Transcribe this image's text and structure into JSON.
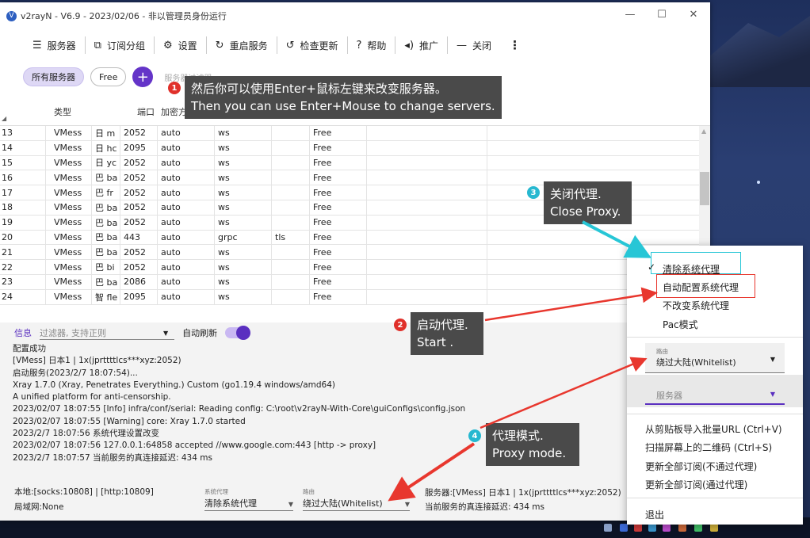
{
  "window": {
    "title": "v2rayN - V6.9 - 2023/02/06 - 非以管理员身份运行",
    "min_glyph": "—",
    "max_glyph": "☐",
    "close_glyph": "✕"
  },
  "toolbar": {
    "items": [
      {
        "icon": "server-icon",
        "glyph": "☰",
        "label": "服务器"
      },
      {
        "icon": "subscription-icon",
        "glyph": "⧉",
        "label": "订阅分组"
      },
      {
        "icon": "settings-icon",
        "glyph": "⚙",
        "label": "设置"
      },
      {
        "icon": "restart-icon",
        "glyph": "↻",
        "label": "重启服务"
      },
      {
        "icon": "update-icon",
        "glyph": "↺",
        "label": "检查更新"
      },
      {
        "icon": "help-icon",
        "glyph": "?",
        "label": "帮助"
      },
      {
        "icon": "promote-icon",
        "glyph": "◂)",
        "label": "推广"
      },
      {
        "icon": "close-icon",
        "glyph": "—",
        "label": "关闭"
      }
    ],
    "more_glyph": "⋮"
  },
  "filters": {
    "chips": [
      "所有服务器",
      "Free"
    ],
    "add_glyph": "+",
    "faint_label": "服务器过滤器"
  },
  "grid": {
    "headers": [
      "类型",
      "端口",
      "加密方式"
    ],
    "rows": [
      {
        "idx": "13",
        "type": "VMess",
        "rem": "日 m",
        "port": "2052",
        "sec": "auto",
        "net": "ws",
        "tls": "",
        "sub": "Free"
      },
      {
        "idx": "14",
        "type": "VMess",
        "rem": "日 hc",
        "port": "2095",
        "sec": "auto",
        "net": "ws",
        "tls": "",
        "sub": "Free"
      },
      {
        "idx": "15",
        "type": "VMess",
        "rem": "日 yc",
        "port": "2052",
        "sec": "auto",
        "net": "ws",
        "tls": "",
        "sub": "Free"
      },
      {
        "idx": "16",
        "type": "VMess",
        "rem": "巴 ba",
        "port": "2052",
        "sec": "auto",
        "net": "ws",
        "tls": "",
        "sub": "Free"
      },
      {
        "idx": "17",
        "type": "VMess",
        "rem": "巴 fr",
        "port": "2052",
        "sec": "auto",
        "net": "ws",
        "tls": "",
        "sub": "Free"
      },
      {
        "idx": "18",
        "type": "VMess",
        "rem": "巴 ba",
        "port": "2052",
        "sec": "auto",
        "net": "ws",
        "tls": "",
        "sub": "Free"
      },
      {
        "idx": "19",
        "type": "VMess",
        "rem": "巴 ba",
        "port": "2052",
        "sec": "auto",
        "net": "ws",
        "tls": "",
        "sub": "Free"
      },
      {
        "idx": "20",
        "type": "VMess",
        "rem": "巴 ba",
        "port": "443",
        "sec": "auto",
        "net": "grpc",
        "tls": "tls",
        "sub": "Free"
      },
      {
        "idx": "21",
        "type": "VMess",
        "rem": "巴 ba",
        "port": "2052",
        "sec": "auto",
        "net": "ws",
        "tls": "",
        "sub": "Free"
      },
      {
        "idx": "22",
        "type": "VMess",
        "rem": "巴 bi",
        "port": "2052",
        "sec": "auto",
        "net": "ws",
        "tls": "",
        "sub": "Free"
      },
      {
        "idx": "23",
        "type": "VMess",
        "rem": "巴 ba",
        "port": "2086",
        "sec": "auto",
        "net": "ws",
        "tls": "",
        "sub": "Free"
      },
      {
        "idx": "24",
        "type": "VMess",
        "rem": "智 fle",
        "port": "2095",
        "sec": "auto",
        "net": "ws",
        "tls": "",
        "sub": "Free"
      }
    ]
  },
  "log": {
    "tab_label": "信息",
    "filter_placeholder": "过滤器, 支持正则",
    "auto_refresh_label": "自动刷新",
    "lines": [
      "配置成功",
      "[VMess] 日本1 | 1x(jprttttlcs***xyz:2052)",
      "启动服务(2023/2/7 18:07:54)...",
      "Xray 1.7.0 (Xray, Penetrates Everything.) Custom (go1.19.4 windows/amd64)",
      "A unified platform for anti-censorship.",
      "2023/02/07 18:07:55 [Info] infra/conf/serial: Reading config: C:\\root\\v2rayN-With-Core\\guiConfigs\\config.json",
      "2023/02/07 18:07:55 [Warning] core: Xray 1.7.0 started",
      "2023/2/7 18:07:56 系统代理设置改变",
      "2023/02/07 18:07:56 127.0.0.1:64858 accepted //www.google.com:443 [http -> proxy]",
      "2023/2/7 18:07:57 当前服务的真连接延迟: 434 ms"
    ]
  },
  "status": {
    "local": "本地:[socks:10808] | [http:10809]",
    "lan": "局域网:None",
    "sysproxy_label": "系统代理",
    "sysproxy_value": "清除系统代理",
    "routing_label": "路由",
    "routing_value": "绕过大陆(Whitelist)",
    "server_info": "服务器:[VMess] 日本1 | 1x(jprttttlcs***xyz:2052)",
    "delay": "当前服务的真连接延迟: 434 ms"
  },
  "tray": {
    "proxy_items": [
      "清除系统代理",
      "自动配置系统代理",
      "不改变系统代理",
      "Pac模式"
    ],
    "checkmark": "✓",
    "routing_label": "路由",
    "routing_value": "绕过大陆(Whitelist)",
    "server_label": "服务器",
    "actions": [
      "从剪贴板导入批量URL (Ctrl+V)",
      "扫描屏幕上的二维码 (Ctrl+S)",
      "更新全部订阅(不通过代理)",
      "更新全部订阅(通过代理)"
    ],
    "exit_label": "退出"
  },
  "callouts": [
    {
      "num": "1",
      "zh": "然后你可以使用Enter+鼠标左键来改变服务器。",
      "en": "Then you can use Enter+Mouse to change servers."
    },
    {
      "num": "2",
      "zh": "启动代理.",
      "en": "Start ."
    },
    {
      "num": "3",
      "zh": "关闭代理.",
      "en": "Close Proxy."
    },
    {
      "num": "4",
      "zh": "代理模式.",
      "en": "Proxy mode."
    }
  ],
  "colors": {
    "accent": "#5a2fc0",
    "callout_bg": "#4a4a4a",
    "red_arrow": "#e8372e",
    "cyan_arrow": "#27c6d6",
    "badge_red": "#e0302a",
    "badge_cyan": "#26b8d0"
  }
}
